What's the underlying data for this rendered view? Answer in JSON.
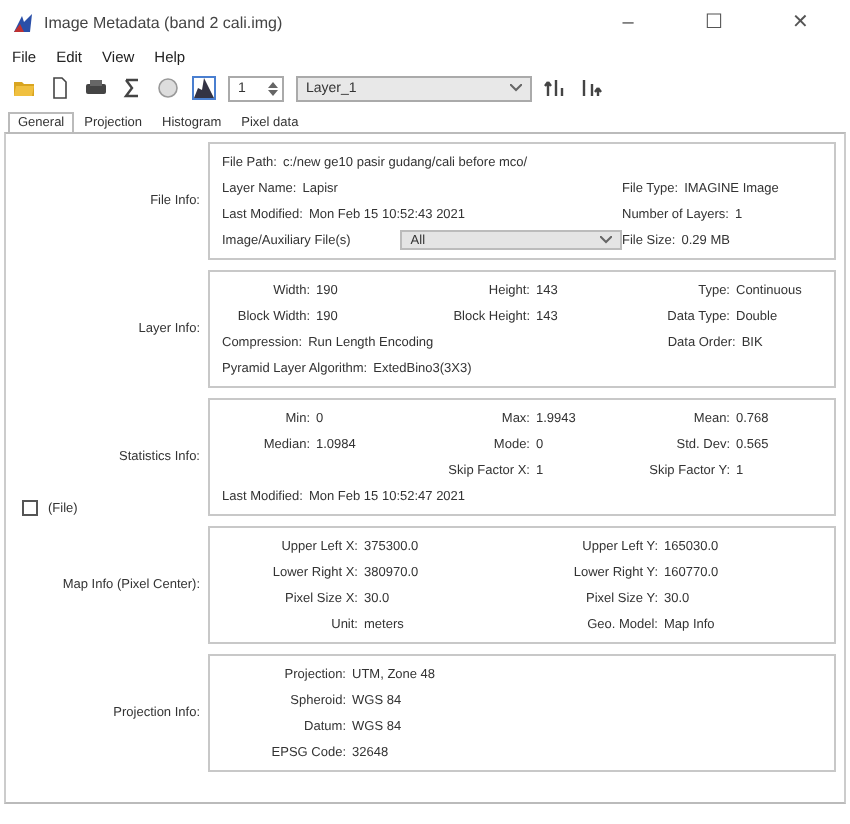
{
  "window": {
    "title": "Image Metadata (band 2 cali.img)",
    "controls": [
      "–",
      "☐",
      "✕"
    ]
  },
  "menu": [
    "File",
    "Edit",
    "View",
    "Help"
  ],
  "toolbar": {
    "layer_number": "1",
    "layer": "Layer_1"
  },
  "tabs": [
    {
      "label": "General",
      "selected": true
    },
    {
      "label": "Projection",
      "selected": false
    },
    {
      "label": "Histogram",
      "selected": false
    },
    {
      "label": "Pixel data",
      "selected": false
    }
  ],
  "sections": [
    {
      "label": "File Info:",
      "rows": [
        {
          "kind": "wide",
          "cells": [
            {
              "label": "File Path:",
              "value": "c:/new ge10 pasir gudang/cali before mco/"
            }
          ]
        },
        {
          "kind": "grid",
          "cells": [
            {
              "label": "Layer Name:",
              "value": "Lapisr"
            },
            "",
            {
              "label": "File Type:",
              "value": "IMAGINE Image"
            }
          ]
        },
        {
          "kind": "free",
          "cells": [
            {
              "label": "Last Modified:",
              "value": "Mon Feb 15 10:52:43 2021"
            },
            {
              "label": "Number of Layers:",
              "value": "1"
            }
          ]
        },
        {
          "kind": "aux",
          "cells": [
            {
              "label": "Image/Auxiliary File(s)",
              "value": "All",
              "kind": "select"
            },
            {
              "label": "File Size:",
              "value": "0.29 MB"
            }
          ]
        }
      ]
    },
    {
      "label": "Layer Info:",
      "rows": [
        {
          "kind": "grid",
          "cells": [
            {
              "label": "Width:",
              "value": "190"
            },
            {
              "label": "Height:",
              "value": "143"
            },
            {
              "label": "Type:",
              "value": "Continuous"
            }
          ]
        },
        {
          "kind": "grid",
          "cells": [
            {
              "label": "Block Width:",
              "value": "190"
            },
            {
              "label": "Block Height:",
              "value": "143"
            },
            {
              "label": "Data Type:",
              "value": "Double"
            }
          ]
        },
        {
          "kind": "grid",
          "cells": [
            {
              "label": "Compression:",
              "value": "Run Length Encoding"
            },
            "",
            {
              "label": "Data Order:",
              "value": "BIK"
            }
          ]
        },
        {
          "kind": "free",
          "cells": [
            {
              "label": "Pyramid Layer Algorithm:",
              "value": "ExtedBino3(3X3)"
            }
          ]
        }
      ]
    },
    {
      "label": "Statistics Info:",
      "checkbox": {
        "label": "(File)",
        "checked": false
      },
      "rows": [
        {
          "kind": "grid",
          "cells": [
            {
              "label": "Min:",
              "value": "0"
            },
            {
              "label": "Max:",
              "value": "1.9943"
            },
            {
              "label": "Mean:",
              "value": "0.768"
            }
          ]
        },
        {
          "kind": "grid",
          "cells": [
            {
              "label": "Median:",
              "value": "1.0984"
            },
            {
              "label": "Mode:",
              "value": "0"
            },
            {
              "label": "Std. Dev:",
              "value": "0.565"
            }
          ]
        },
        {
          "kind": "grid",
          "cells": [
            "",
            {
              "label": "Skip Factor X:",
              "value": "1"
            },
            {
              "label": "Skip Factor Y:",
              "value": "1"
            }
          ]
        },
        {
          "kind": "free",
          "cells": [
            {
              "label": "Last Modified:",
              "value": "Mon Feb 15 10:52:47 2021"
            }
          ]
        }
      ]
    },
    {
      "label": "Map Info (Pixel Center):",
      "rows": [
        {
          "kind": "grid",
          "cells": [
            {
              "label": "Upper Left X:",
              "value": "375300.0"
            },
            {
              "label": "Upper Left Y:",
              "value": "165030.0"
            }
          ]
        },
        {
          "kind": "grid",
          "cells": [
            {
              "label": "Lower Right X:",
              "value": "380970.0"
            },
            {
              "label": "Lower Right Y:",
              "value": "160770.0"
            }
          ]
        },
        {
          "kind": "grid",
          "cells": [
            {
              "label": "Pixel Size X:",
              "value": "30.0"
            },
            {
              "label": "Pixel Size Y:",
              "value": "30.0"
            }
          ]
        },
        {
          "kind": "grid",
          "cells": [
            {
              "label": "Unit:",
              "value": "meters"
            },
            {
              "label": "Geo. Model:",
              "value": "Map Info"
            }
          ]
        }
      ]
    },
    {
      "label": "Projection Info:",
      "rows": [
        {
          "kind": "grid",
          "cells": [
            {
              "label": "Projection:",
              "value": "UTM, Zone 48"
            }
          ]
        },
        {
          "kind": "grid",
          "cells": [
            {
              "label": "Spheroid:",
              "value": "WGS 84"
            }
          ]
        },
        {
          "kind": "grid",
          "cells": [
            {
              "label": "Datum:",
              "value": "WGS 84"
            }
          ]
        },
        {
          "kind": "grid",
          "cells": [
            {
              "label": "EPSG Code:",
              "value": "32648"
            }
          ]
        }
      ]
    }
  ]
}
